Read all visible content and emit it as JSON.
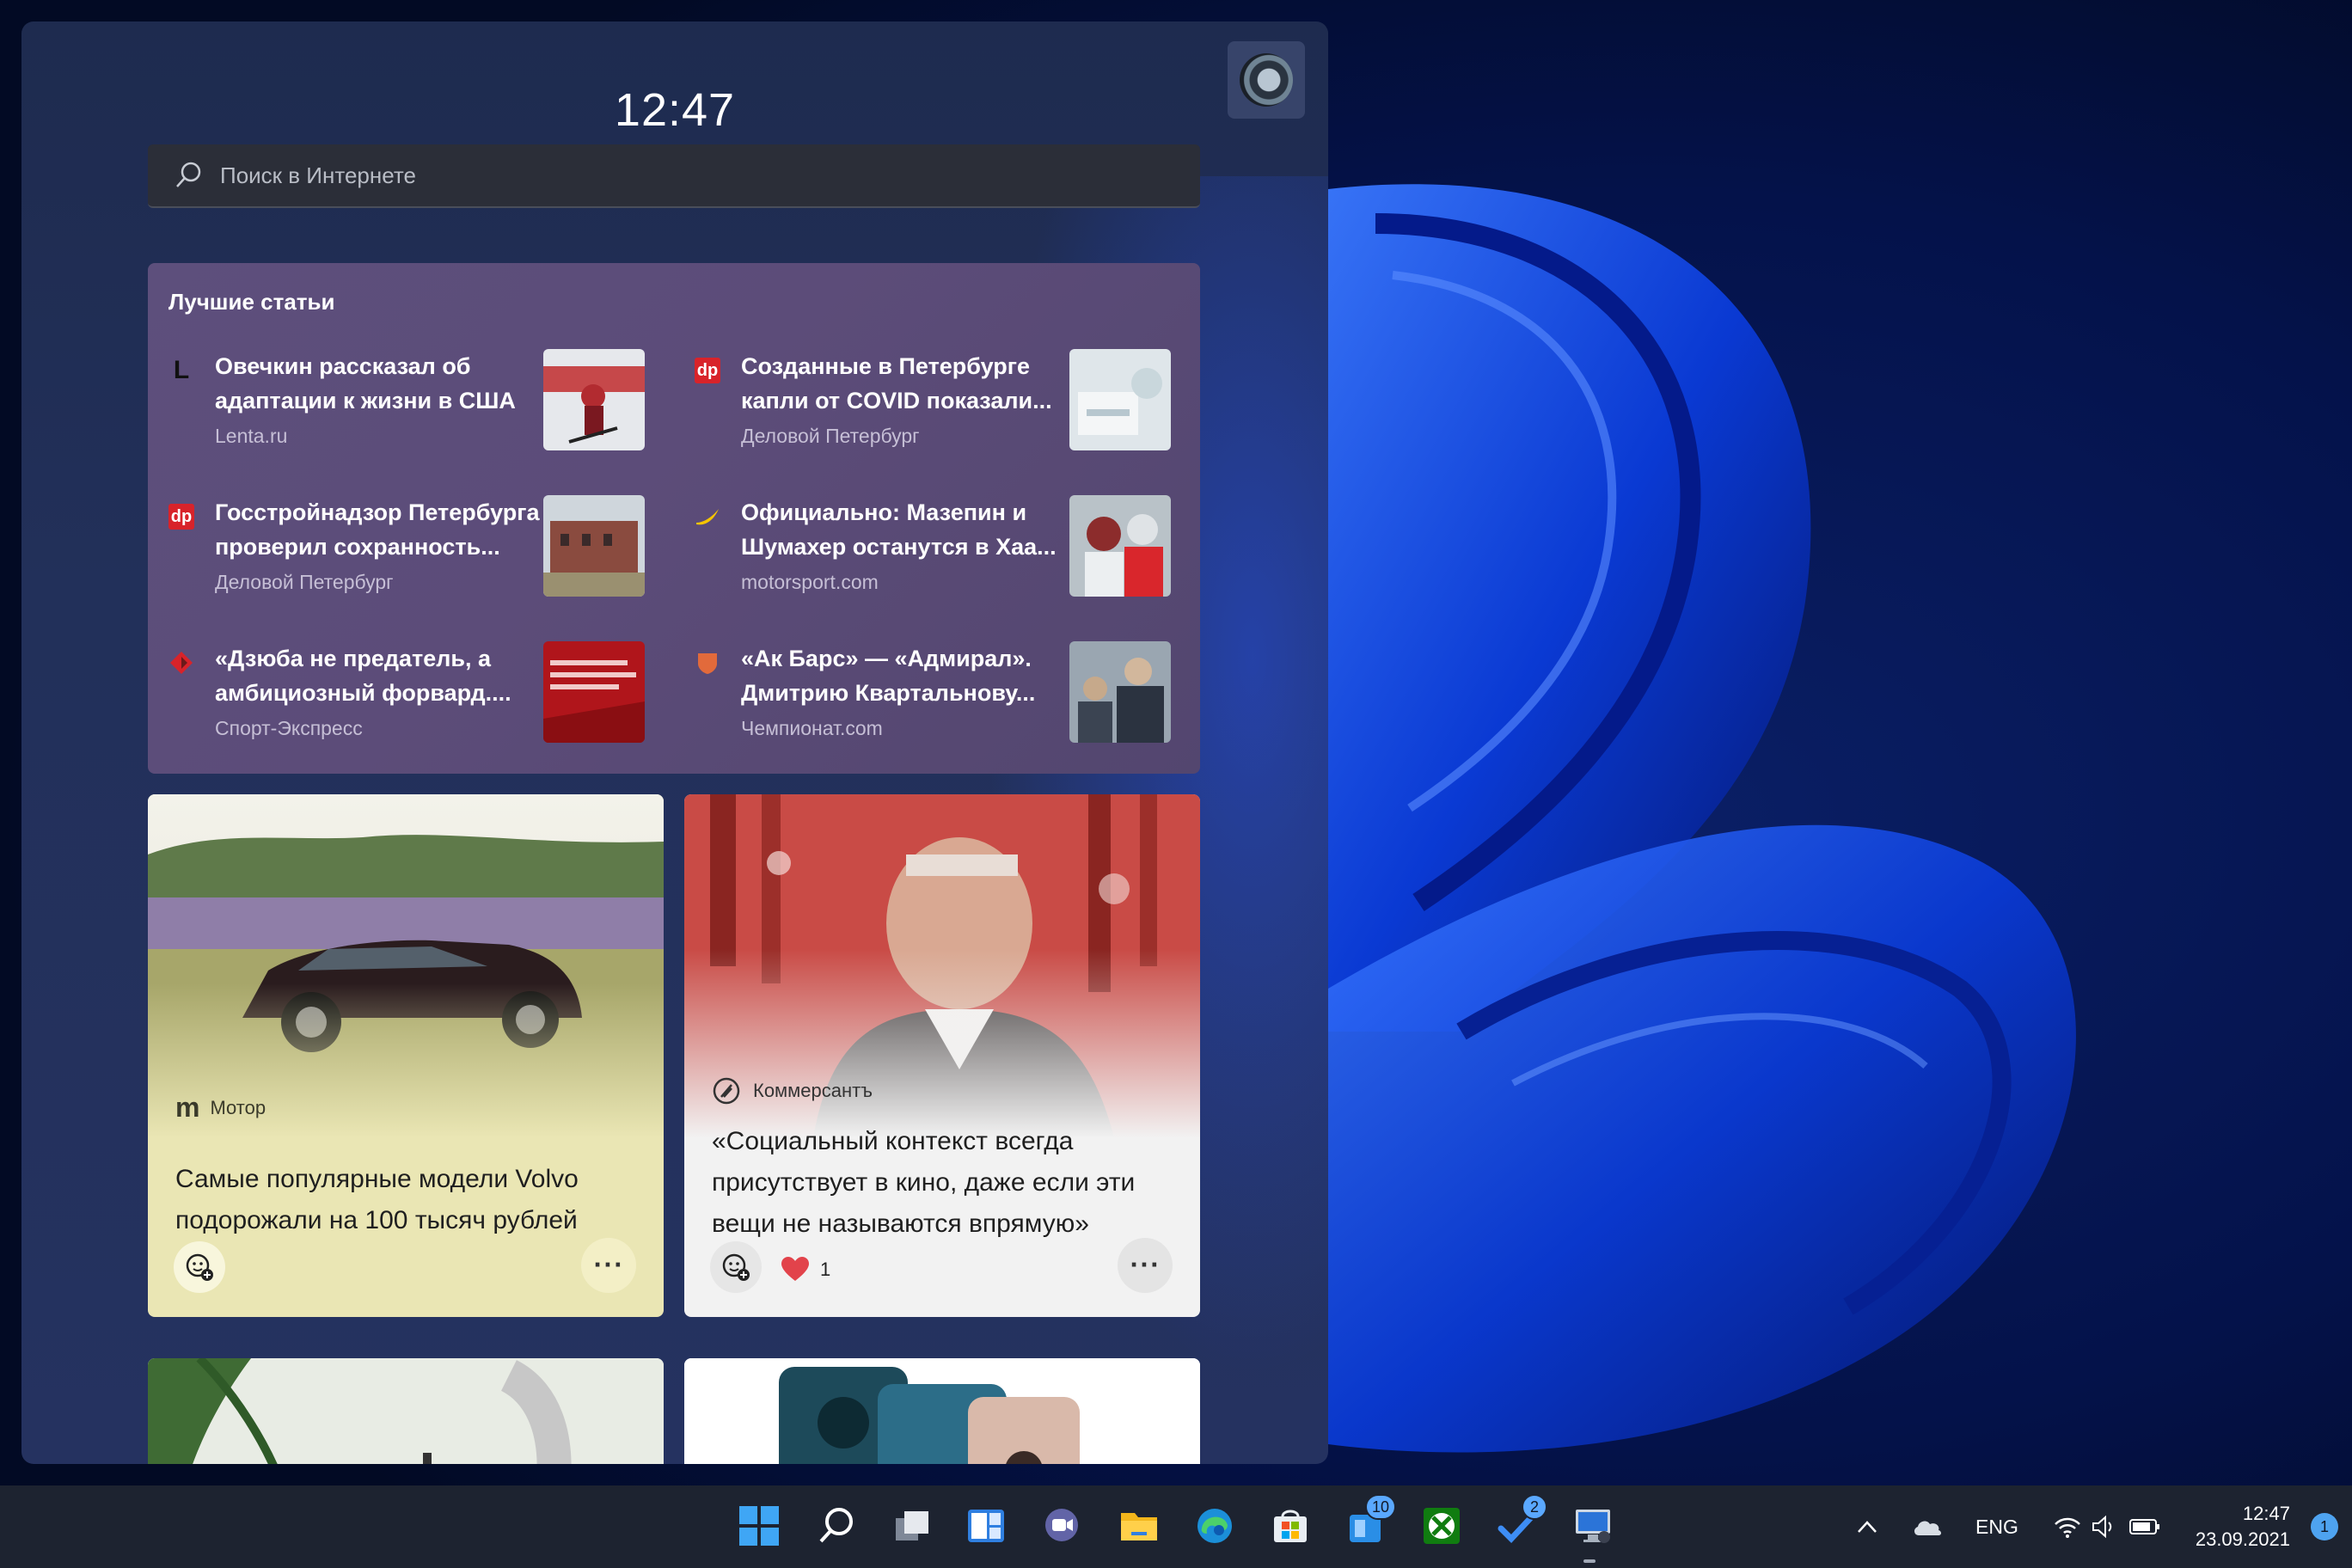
{
  "widgets": {
    "clock": "12:47",
    "search": {
      "placeholder": "Поиск в Интернете"
    },
    "top_stories": {
      "header": "Лучшие статьи",
      "articles": [
        {
          "title": "Овечкин рассказал об адаптации к жизни в США",
          "source": "Lenta.ru",
          "logo": "L"
        },
        {
          "title": "Созданные в Петербурге капли от COVID показали...",
          "source": "Деловой Петербург",
          "logo": "dp"
        },
        {
          "title": "Госстройнадзор Петербурга проверил сохранность...",
          "source": "Деловой Петербург",
          "logo": "dp"
        },
        {
          "title": "Официально: Мазепин и Шумахер останутся в Хаа...",
          "source": "motorsport.com",
          "logo": ""
        },
        {
          "title": "«Дзюба не предатель, а амбициозный форвард....",
          "source": "Спорт-Экспресс",
          "logo": ""
        },
        {
          "title": "«Ак Барс» — «Адмирал». Дмитрию Квартальнову...",
          "source": "Чемпионат.com",
          "logo": ""
        }
      ]
    },
    "cards": [
      {
        "source": "Мотор",
        "logo": "m",
        "headline": "Самые популярные модели Volvo подорожали на 100 тысяч рублей",
        "more": "···"
      },
      {
        "source": "Коммерсантъ",
        "headline": "«Социальный контекст всегда присутствует в кино, даже если эти вещи не называются впрямую»",
        "likes": "1",
        "more": "···"
      }
    ]
  },
  "taskbar": {
    "badges": {
      "store_widget": "10",
      "todo": "2"
    },
    "tray": {
      "language": "ENG",
      "time": "12:47",
      "date": "23.09.2021",
      "notifications": "1"
    }
  },
  "colors": {
    "accent": "#1f6bd6",
    "panel": "#22305a",
    "top_stories_bg": "#5c4c79",
    "card_motor_bg": "#eae6b4",
    "card_kommersant_bg": "#f2f2f2"
  }
}
